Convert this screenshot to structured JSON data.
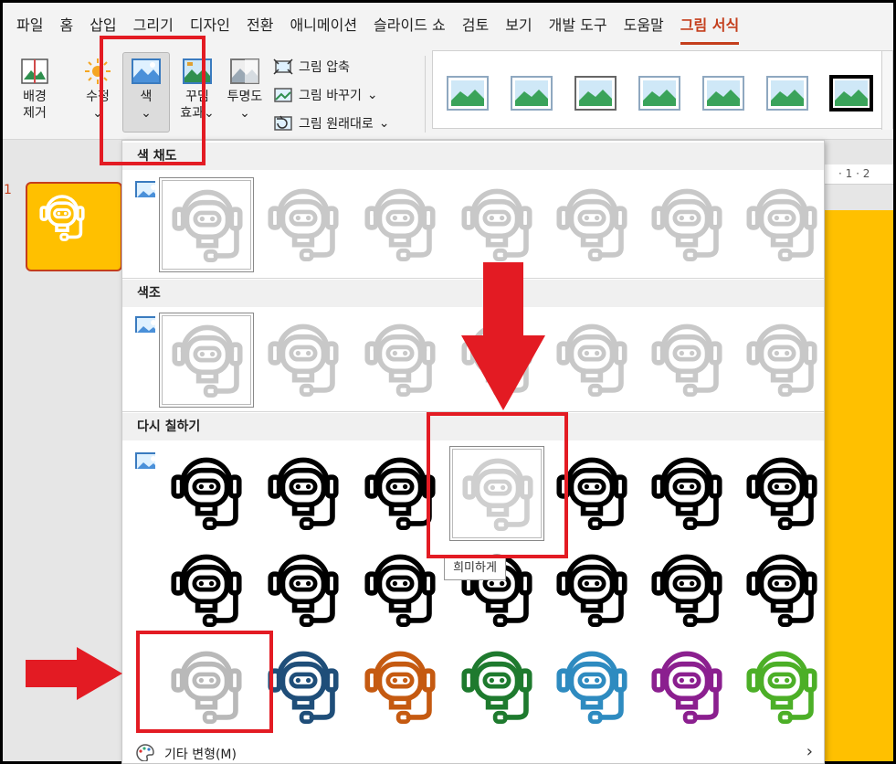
{
  "menu": {
    "tabs": [
      "파일",
      "홈",
      "삽입",
      "그리기",
      "디자인",
      "전환",
      "애니메이션",
      "슬라이드 쇼",
      "검토",
      "보기",
      "개발 도구",
      "도움말",
      "그림 서식"
    ],
    "active_tab": "그림 서식"
  },
  "ribbon": {
    "remove_bg_line1": "배경",
    "remove_bg_line2": "제거",
    "corrections": "수정",
    "color": "색",
    "artistic_line1": "꾸밈",
    "artistic_line2": "효과",
    "transparency": "투명도",
    "compress": "그림 압축",
    "change": "그림 바꾸기",
    "reset": "그림 원래대로",
    "dropdown_chevron": "⌄"
  },
  "slides": {
    "first_number": "1"
  },
  "ruler": {
    "marks": "· 1 · 2"
  },
  "dropdown": {
    "section_saturation": "색 채도",
    "section_tone": "색조",
    "section_recolor": "다시 칠하기",
    "tooltip": "희미하게",
    "more_variations": "기타 변형(M)",
    "more_chevron": "›"
  },
  "colors": {
    "accent_red": "#e31b23",
    "active_tab": "#c43e1c",
    "slide_yellow": "#ffc000",
    "recolor_row3": [
      "#b9b9b9",
      "#1f4e79",
      "#c55a11",
      "#1e7a2e",
      "#2e8bc0",
      "#8b1f8f",
      "#4caf27"
    ]
  },
  "icons": {
    "tile": "robot-headset-icon",
    "saturation": "saturation-icon",
    "tone": "tone-icon",
    "recolor": "recolor-icon",
    "more": "palette-icon"
  }
}
